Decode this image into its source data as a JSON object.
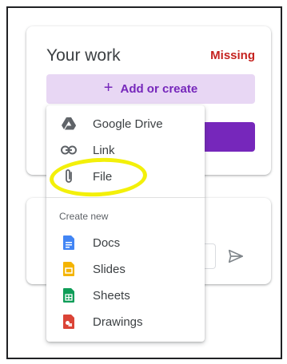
{
  "card": {
    "title": "Your work",
    "status": "Missing",
    "add_button": {
      "icon": "plus-icon",
      "label": "Add or create"
    }
  },
  "menu": {
    "attach_items": [
      {
        "icon": "google-drive-icon",
        "label": "Google Drive"
      },
      {
        "icon": "link-icon",
        "label": "Link"
      },
      {
        "icon": "paperclip-icon",
        "label": "File"
      }
    ],
    "create_section_label": "Create new",
    "create_items": [
      {
        "icon": "docs-icon",
        "label": "Docs",
        "color": "#4285f4"
      },
      {
        "icon": "slides-icon",
        "label": "Slides",
        "color": "#f4b400"
      },
      {
        "icon": "sheets-icon",
        "label": "Sheets",
        "color": "#0f9d58"
      },
      {
        "icon": "drawings-icon",
        "label": "Drawings",
        "color": "#db4437"
      }
    ]
  },
  "colors": {
    "accent": "#7627bb",
    "accent_light": "#e8d7f4",
    "missing": "#c5221f",
    "highlight": "#f3f00a"
  }
}
